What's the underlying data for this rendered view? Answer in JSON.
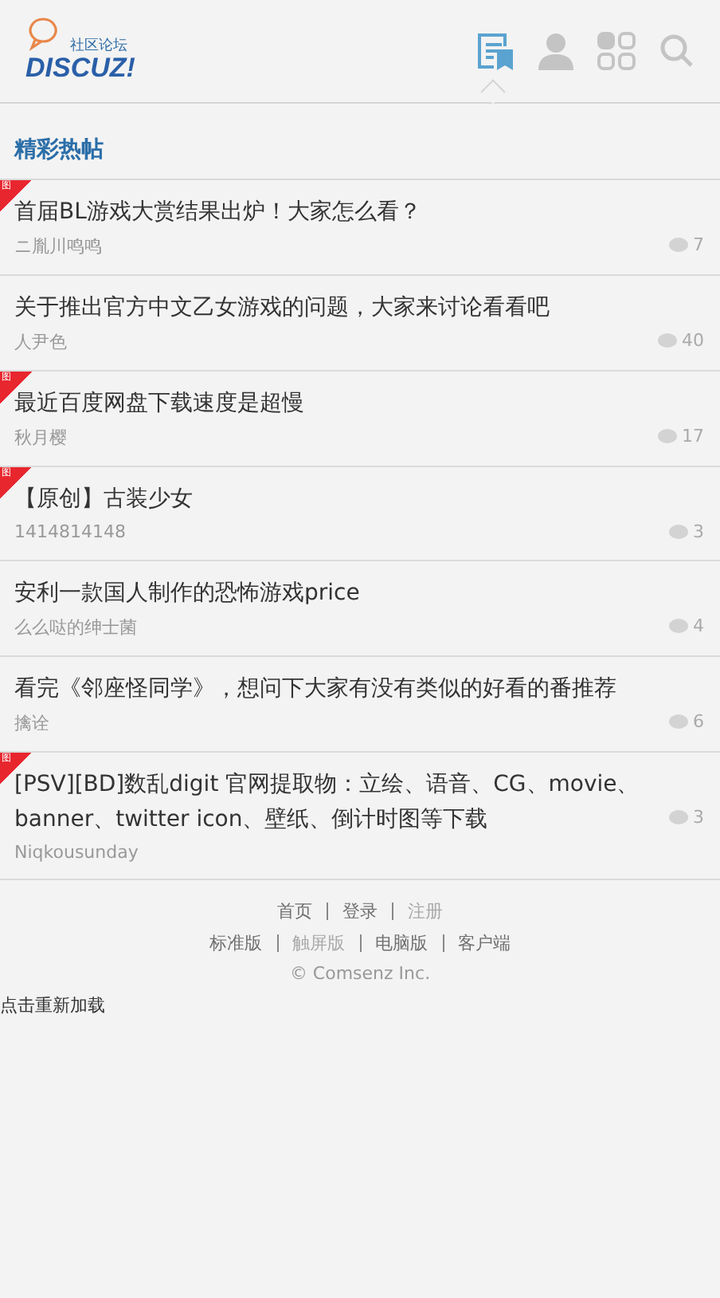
{
  "logo": {
    "tagline": "社区论坛",
    "name": "DISCUZ!"
  },
  "nav": [
    {
      "kind": "threads",
      "selected": true
    },
    {
      "kind": "user",
      "selected": false
    },
    {
      "kind": "apps",
      "selected": false
    },
    {
      "kind": "search",
      "selected": false
    }
  ],
  "section_title": "精彩热帖",
  "threads": [
    {
      "title": "首届BL游戏大赏结果出炉！大家怎么看？",
      "author": "ニ胤川鸣鸣",
      "replies": "7",
      "badge": "图"
    },
    {
      "title": "关于推出官方中文乙女游戏的问题，大家来讨论看看吧",
      "author": "人尹色",
      "replies": "40"
    },
    {
      "title": "最近百度网盘下载速度是超慢",
      "author": "秋月樱",
      "replies": "17",
      "badge": "图"
    },
    {
      "title": "【原创】古装少女",
      "author": "1414814148",
      "replies": "3",
      "badge": "图"
    },
    {
      "title": "安利一款国人制作的恐怖游戏price",
      "author": "么么哒的绅士菌",
      "replies": "4"
    },
    {
      "title": "看完《邻座怪同学》，想问下大家有没有类似的好看的番推荐",
      "author": "擒诠",
      "replies": "6"
    },
    {
      "title": "[PSV][BD]数乱digit 官网提取物：立绘、语音、CG、movie、banner、twitter icon、壁纸、倒计时图等下载",
      "author": "Niqkousunday",
      "replies": "3",
      "badge": "图"
    }
  ],
  "footer_links": [
    {
      "label": "首页",
      "active": false
    },
    {
      "label": "登录",
      "active": false
    },
    {
      "label": "注册",
      "active": true
    }
  ],
  "footer_versions": [
    {
      "label": "标准版",
      "selected": false
    },
    {
      "label": "触屏版",
      "selected": true
    },
    {
      "label": "电脑版",
      "selected": false
    },
    {
      "label": "客户端",
      "selected": false
    }
  ],
  "copyright": "© Comsenz Inc.",
  "reload": "点击重新加载"
}
